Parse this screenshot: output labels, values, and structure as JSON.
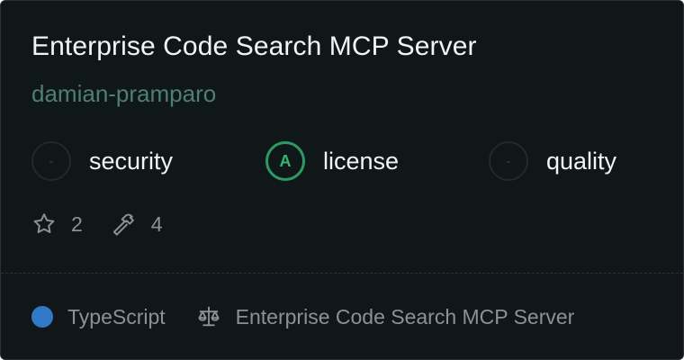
{
  "card": {
    "title": "Enterprise Code Search MCP Server",
    "author": "damian-pramparo",
    "scores": [
      {
        "label": "security",
        "grade": "-"
      },
      {
        "label": "license",
        "grade": "A"
      },
      {
        "label": "quality",
        "grade": "-"
      }
    ],
    "stats": {
      "stars": "2",
      "tools": "4"
    },
    "footer": {
      "language": "TypeScript",
      "language_color": "#3178c6",
      "license": "Enterprise Code Search MCP Server"
    }
  },
  "icons": {
    "stars": "star-icon",
    "tools": "hammer-icon",
    "license": "scale-icon"
  },
  "colors": {
    "background": "#0f1719",
    "grade_a": "#2d9a63",
    "author": "#4e7e74"
  }
}
